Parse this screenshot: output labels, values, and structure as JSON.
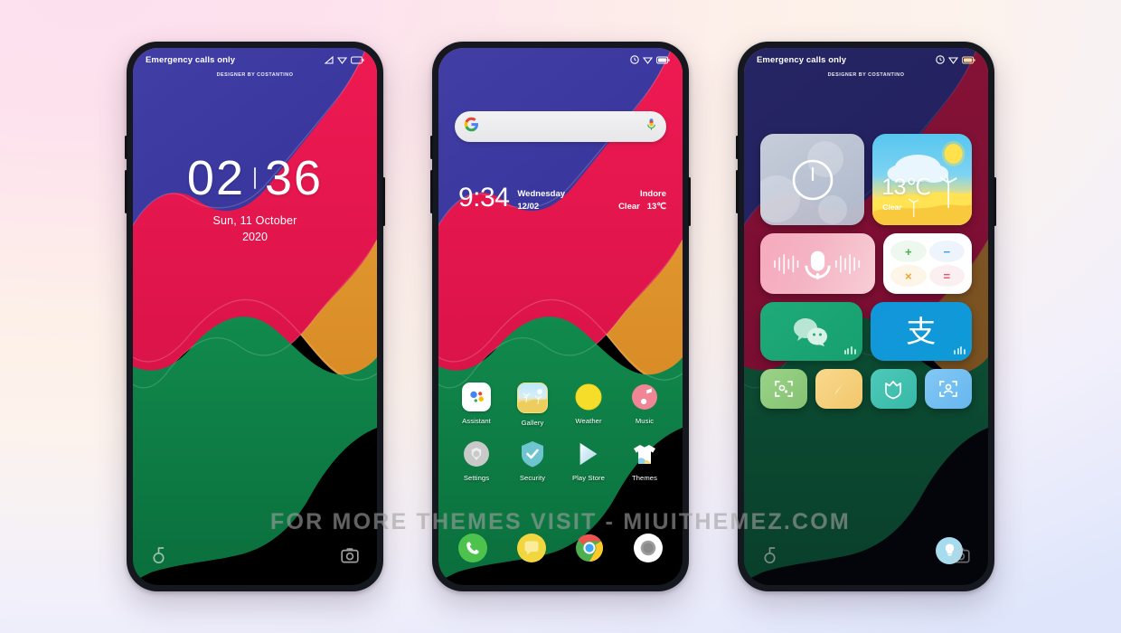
{
  "watermark": "FOR MORE THEMES VISIT - MIUITHEMEZ.COM",
  "designer_credit": "DESIGNER BY COSTANTINO",
  "background": {
    "start_color": "#fde0ee",
    "end_color": "#dfe6fb"
  },
  "wallpaper_colors": {
    "indigo": "#3b3b9e",
    "crimson": "#e8194f",
    "orange": "#e3972f",
    "green": "#0e8047",
    "black": "#000000"
  },
  "phones": [
    {
      "id": "lockscreen",
      "statusbar": {
        "carrier": "Emergency calls only",
        "icons": [
          "signal-icon",
          "wifi-icon",
          "battery-icon"
        ]
      },
      "clock": {
        "hours": "02",
        "minutes": "36",
        "date": "Sun, 11 October",
        "year": "2020"
      },
      "bottom_icons": [
        "flashlight-icon",
        "camera-icon"
      ]
    },
    {
      "id": "homescreen",
      "statusbar": {
        "carrier": "",
        "icons": [
          "alarm-icon",
          "wifi-icon",
          "battery-icon"
        ]
      },
      "search": {
        "placeholder": "",
        "left_icon": "google-g-icon",
        "right_icon": "microphone-icon"
      },
      "clock_widget": {
        "time": "9:34",
        "day": "Wednesday",
        "date": "12/02",
        "city": "Indore",
        "condition": "Clear",
        "temperature": "13℃"
      },
      "apps": [
        [
          {
            "label": "Assistant",
            "icon": "google-assistant-icon"
          },
          {
            "label": "Gallery",
            "icon": "gallery-icon"
          },
          {
            "label": "Weather",
            "icon": "weather-sun-icon"
          },
          {
            "label": "Music",
            "icon": "music-note-icon"
          }
        ],
        [
          {
            "label": "Settings",
            "icon": "settings-gear-icon"
          },
          {
            "label": "Security",
            "icon": "security-shield-icon"
          },
          {
            "label": "Play Store",
            "icon": "play-store-icon"
          },
          {
            "label": "Themes",
            "icon": "themes-shirt-icon"
          }
        ]
      ],
      "dock": [
        {
          "label": "Phone",
          "icon": "phone-handset-icon"
        },
        {
          "label": "Messages",
          "icon": "message-bubble-icon"
        },
        {
          "label": "Chrome",
          "icon": "chrome-icon"
        },
        {
          "label": "Camera",
          "icon": "camera-lens-icon"
        }
      ]
    },
    {
      "id": "widgets",
      "statusbar": {
        "carrier": "Emergency calls only",
        "icons": [
          "alarm-icon",
          "wifi-icon",
          "battery-icon"
        ]
      },
      "widgets": {
        "clock": {
          "icon": "analog-clock-icon"
        },
        "weather": {
          "temperature": "13℃",
          "condition": "Clear",
          "icon": "sun-cloud-windmill-icon"
        },
        "voice": {
          "icon": "microphone-waveform-icon"
        },
        "calculator": {
          "icon": "calculator-icon",
          "keys": [
            {
              "symbol": "+",
              "color": "#4caf50"
            },
            {
              "symbol": "−",
              "color": "#3f9ae0"
            },
            {
              "symbol": "×",
              "color": "#f0a22e"
            },
            {
              "symbol": "=",
              "color": "#e0536b"
            }
          ]
        },
        "wechat": {
          "icon": "wechat-icon"
        },
        "alipay": {
          "icon": "alipay-icon",
          "glyph": "支"
        },
        "small": [
          {
            "icon": "scan-code-icon",
            "color": "#8cc97a"
          },
          {
            "icon": "compass-needle-icon",
            "color": "#f6cf7e"
          },
          {
            "icon": "mi-security-icon",
            "color": "#3fbfb0"
          },
          {
            "icon": "scan-person-icon",
            "color": "#6fbdef"
          }
        ]
      },
      "bottom_icons": [
        "flashlight-icon",
        "lightbulb-icon",
        "camera-icon"
      ]
    }
  ]
}
